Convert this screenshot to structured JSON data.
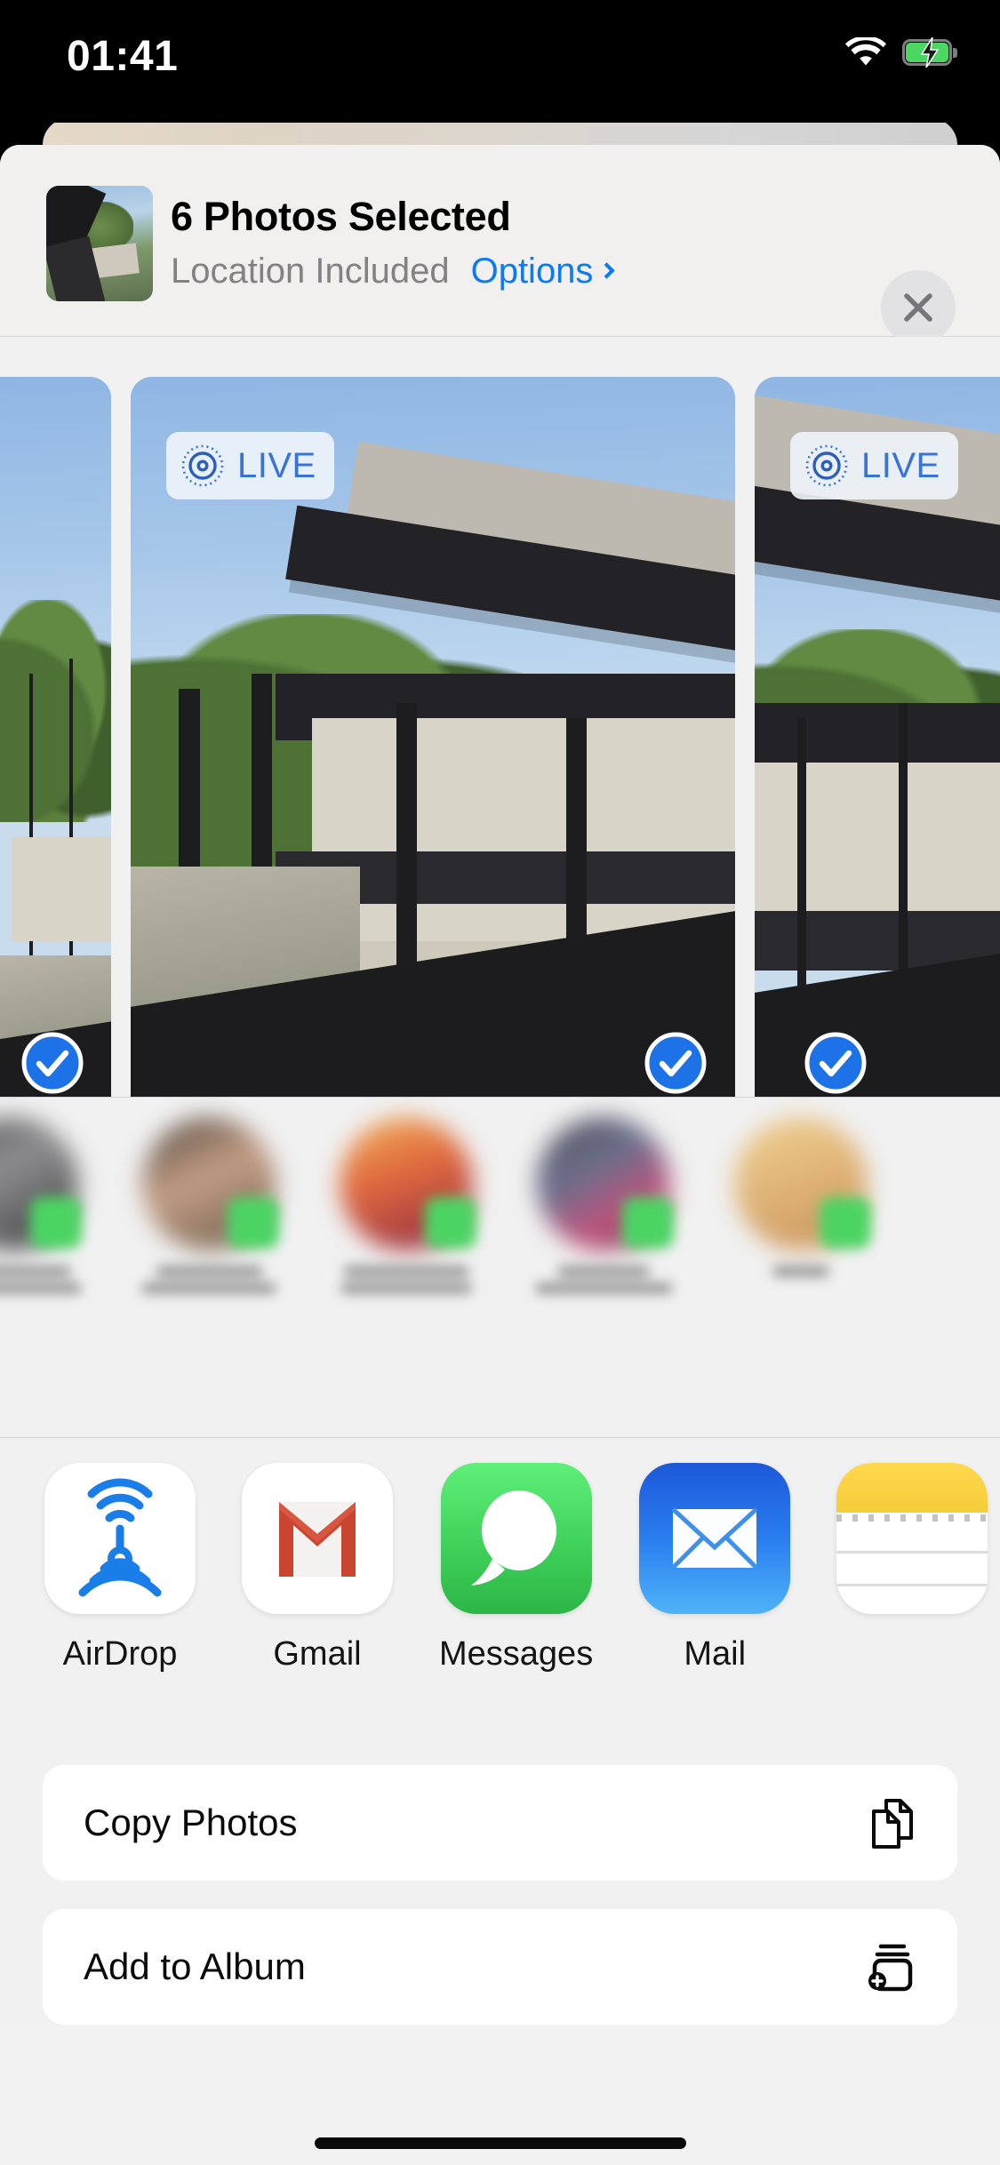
{
  "statusbar": {
    "time": "01:41",
    "wifi_icon": "wifi-icon",
    "battery_icon": "battery-charging-icon",
    "battery_color": "#4cd663"
  },
  "share_sheet": {
    "header": {
      "thumbnail_name": "selected-photo-thumbnail",
      "title": "6 Photos Selected",
      "subtitle": "Location Included",
      "options_label": "Options",
      "options_chevron": "chevron-right-icon",
      "close_label": "close-icon",
      "accent_color": "#0a7bf2",
      "subtitle_color": "#828285"
    },
    "photo_strip": {
      "live_badge_label": "LIVE",
      "live_badge_color": "#3774d6",
      "selected_check_color": "#1d72e8",
      "items": [
        {
          "name": "photo-1",
          "live": false,
          "selected": true,
          "partial": "left"
        },
        {
          "name": "photo-2",
          "live": true,
          "selected": true,
          "partial": "none"
        },
        {
          "name": "photo-3",
          "live": true,
          "selected": true,
          "partial": "right"
        }
      ]
    },
    "contacts": [
      {
        "name": "contact-1",
        "label_blurred": true,
        "badge": "messages-badge"
      },
      {
        "name": "contact-2",
        "label_blurred": true,
        "badge": "messages-badge"
      },
      {
        "name": "contact-3",
        "label_blurred": true,
        "badge": "messages-badge"
      },
      {
        "name": "contact-4",
        "label_blurred": true,
        "badge": "messages-badge"
      },
      {
        "name": "contact-5",
        "label_blurred": true,
        "badge": "messages-badge"
      }
    ],
    "apps": [
      {
        "label": "AirDrop",
        "icon": "airdrop-icon"
      },
      {
        "label": "Gmail",
        "icon": "gmail-icon"
      },
      {
        "label": "Messages",
        "icon": "messages-icon"
      },
      {
        "label": "Mail",
        "icon": "mail-icon"
      },
      {
        "label": "",
        "icon": "notes-icon"
      }
    ],
    "actions": [
      {
        "label": "Copy Photos",
        "icon": "copy-documents-icon"
      },
      {
        "label": "Add to Album",
        "icon": "add-to-album-icon"
      }
    ]
  },
  "home_indicator": "home-indicator"
}
